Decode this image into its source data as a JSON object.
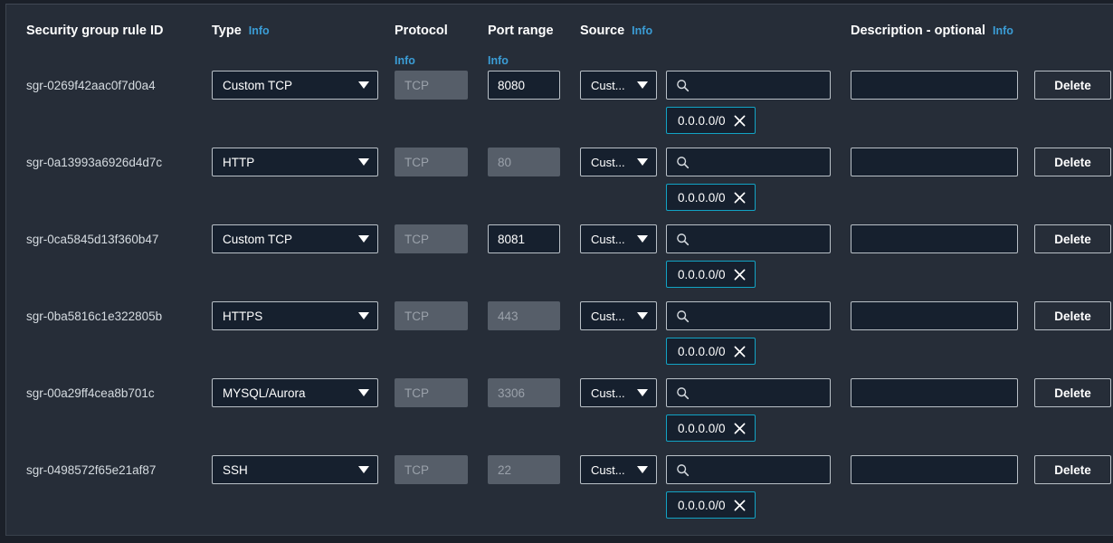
{
  "table": {
    "headers": {
      "rule_id": "Security group rule ID",
      "type": "Type",
      "type_info": "Info",
      "protocol": "Protocol",
      "protocol_info": "Info",
      "port_range": "Port range",
      "port_range_info": "Info",
      "source": "Source",
      "source_info": "Info",
      "description": "Description - optional",
      "description_info": "Info"
    },
    "rows": [
      {
        "rule_id": "sgr-0269f42aac0f7d0a4",
        "type": "Custom TCP",
        "protocol": "TCP",
        "port": "8080",
        "port_disabled": false,
        "source": "Cust...",
        "search_value": "",
        "description": "",
        "chip": "0.0.0.0/0",
        "delete_label": "Delete"
      },
      {
        "rule_id": "sgr-0a13993a6926d4d7c",
        "type": "HTTP",
        "protocol": "TCP",
        "port": "80",
        "port_disabled": true,
        "source": "Cust...",
        "search_value": "",
        "description": "",
        "chip": "0.0.0.0/0",
        "delete_label": "Delete"
      },
      {
        "rule_id": "sgr-0ca5845d13f360b47",
        "type": "Custom TCP",
        "protocol": "TCP",
        "port": "8081",
        "port_disabled": false,
        "source": "Cust...",
        "search_value": "",
        "description": "",
        "chip": "0.0.0.0/0",
        "delete_label": "Delete"
      },
      {
        "rule_id": "sgr-0ba5816c1e322805b",
        "type": "HTTPS",
        "protocol": "TCP",
        "port": "443",
        "port_disabled": true,
        "source": "Cust...",
        "search_value": "",
        "description": "",
        "chip": "0.0.0.0/0",
        "delete_label": "Delete"
      },
      {
        "rule_id": "sgr-00a29ff4cea8b701c",
        "type": "MYSQL/Aurora",
        "protocol": "TCP",
        "port": "3306",
        "port_disabled": true,
        "source": "Cust...",
        "search_value": "",
        "description": "",
        "chip": "0.0.0.0/0",
        "delete_label": "Delete"
      },
      {
        "rule_id": "sgr-0498572f65e21af87",
        "type": "SSH",
        "protocol": "TCP",
        "port": "22",
        "port_disabled": true,
        "source": "Cust...",
        "search_value": "",
        "description": "",
        "chip": "0.0.0.0/0",
        "delete_label": "Delete"
      }
    ]
  },
  "icons": {
    "search": "search-icon",
    "chip_remove": "close-icon",
    "dropdown": "chevron-down-icon"
  },
  "colors": {
    "panel_bg": "#262d38",
    "field_bg": "#16202e",
    "border": "#b9c0c7",
    "info_link": "#3b9dd6",
    "chip_border": "#12a3c4",
    "disabled_bg": "#565e69"
  }
}
